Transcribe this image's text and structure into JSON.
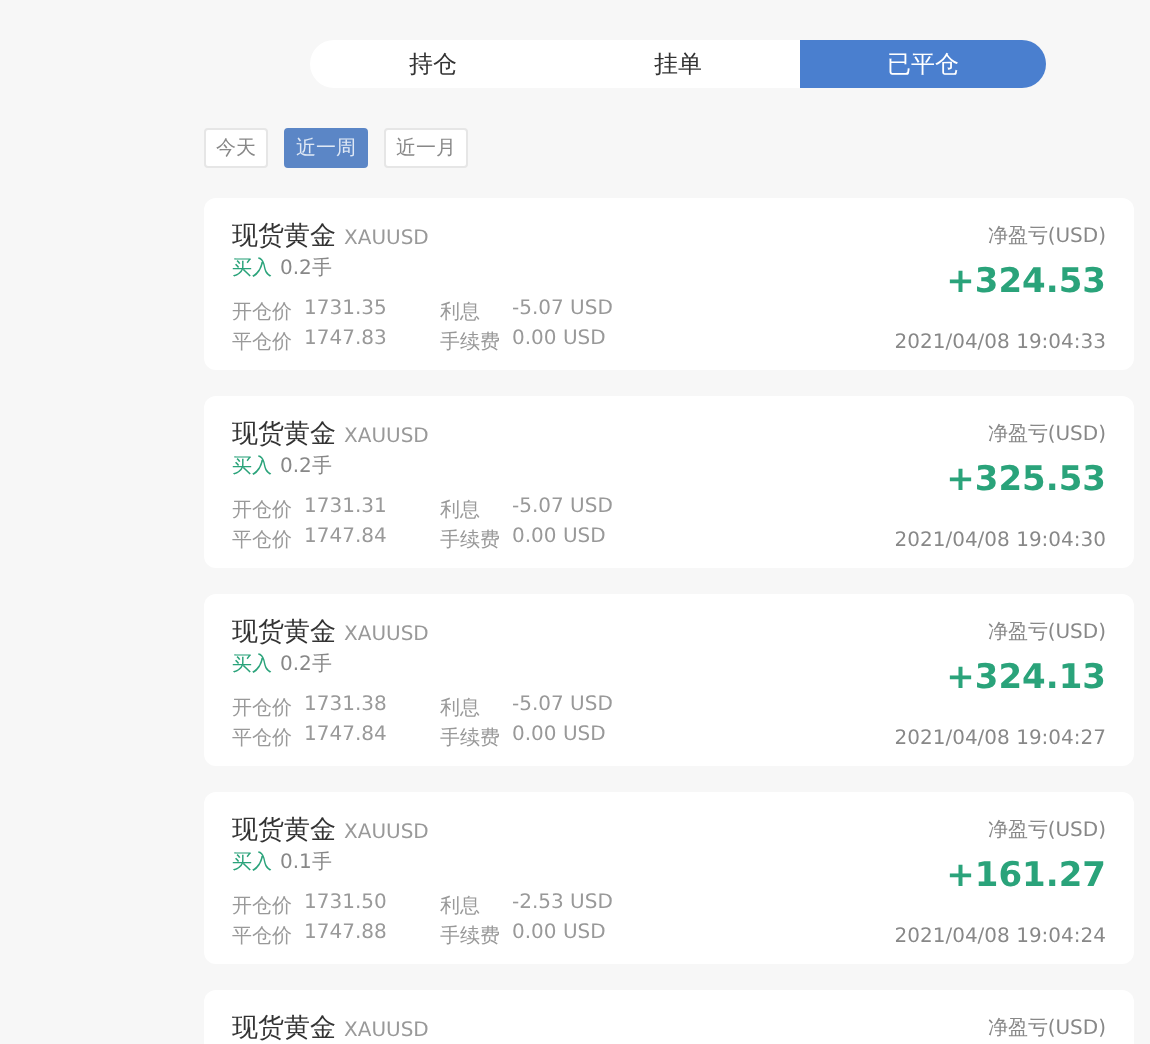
{
  "tabs": [
    {
      "label": "持仓",
      "selected": false
    },
    {
      "label": "挂单",
      "selected": false
    },
    {
      "label": "已平仓",
      "selected": true
    }
  ],
  "filters": [
    {
      "label": "今天",
      "selected": false
    },
    {
      "label": "近一周",
      "selected": true
    },
    {
      "label": "近一月",
      "selected": false
    }
  ],
  "orders": [
    {
      "name": "现货黄金",
      "symbol": "XAUUSD",
      "side": "买入",
      "lots": "0.2手",
      "open_label": "开仓价",
      "open_price": "1731.35",
      "close_label": "平仓价",
      "close_price": "1747.83",
      "interest_label": "利息",
      "interest": "-5.07 USD",
      "fee_label": "手续费",
      "fee": "0.00 USD",
      "pnl_label": "净盈亏(USD)",
      "pnl": "+324.53",
      "time": "2021/04/08 19:04:33"
    },
    {
      "name": "现货黄金",
      "symbol": "XAUUSD",
      "side": "买入",
      "lots": "0.2手",
      "open_label": "开仓价",
      "open_price": "1731.31",
      "close_label": "平仓价",
      "close_price": "1747.84",
      "interest_label": "利息",
      "interest": "-5.07 USD",
      "fee_label": "手续费",
      "fee": "0.00 USD",
      "pnl_label": "净盈亏(USD)",
      "pnl": "+325.53",
      "time": "2021/04/08 19:04:30"
    },
    {
      "name": "现货黄金",
      "symbol": "XAUUSD",
      "side": "买入",
      "lots": "0.2手",
      "open_label": "开仓价",
      "open_price": "1731.38",
      "close_label": "平仓价",
      "close_price": "1747.84",
      "interest_label": "利息",
      "interest": "-5.07 USD",
      "fee_label": "手续费",
      "fee": "0.00 USD",
      "pnl_label": "净盈亏(USD)",
      "pnl": "+324.13",
      "time": "2021/04/08 19:04:27"
    },
    {
      "name": "现货黄金",
      "symbol": "XAUUSD",
      "side": "买入",
      "lots": "0.1手",
      "open_label": "开仓价",
      "open_price": "1731.50",
      "close_label": "平仓价",
      "close_price": "1747.88",
      "interest_label": "利息",
      "interest": "-2.53 USD",
      "fee_label": "手续费",
      "fee": "0.00 USD",
      "pnl_label": "净盈亏(USD)",
      "pnl": "+161.27",
      "time": "2021/04/08 19:04:24"
    },
    {
      "name": "现货黄金",
      "symbol": "XAUUSD",
      "pnl_label": "净盈亏(USD)"
    }
  ]
}
